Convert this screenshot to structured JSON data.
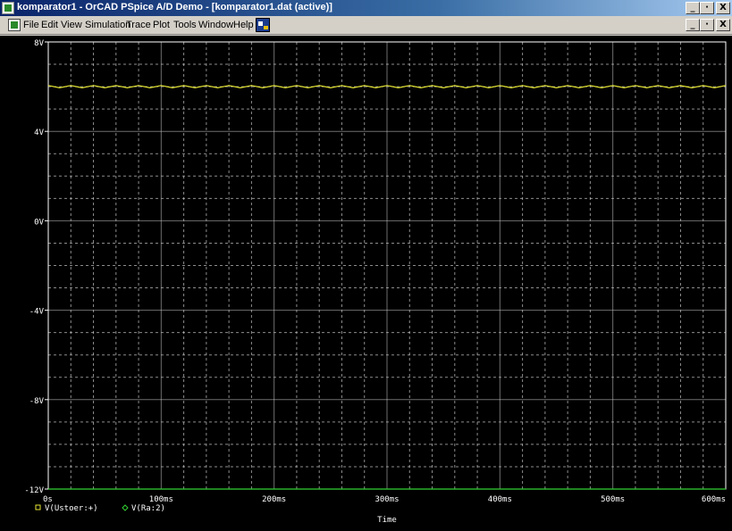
{
  "window": {
    "title": "komparator1 - OrCAD PSpice A/D Demo  - [komparator1.dat (active)]",
    "caption_buttons": [
      "_",
      "·",
      "X"
    ]
  },
  "menu": {
    "items": [
      "File",
      "Edit",
      "View",
      "Simulation",
      "Trace",
      "Plot",
      "Tools",
      "Window",
      "Help"
    ],
    "doc_buttons": [
      "_",
      "·",
      "X"
    ]
  },
  "colors": {
    "background": "#000000",
    "grid": "#c8c8c8",
    "axis": "#ffffff",
    "trace_yellow": "#e6e632",
    "trace_green": "#32d232"
  },
  "chart_data": {
    "type": "line",
    "xlabel": "Time",
    "ylabel": "",
    "x_unit": "ms",
    "xlim": [
      0,
      600
    ],
    "ylim": [
      -12,
      8
    ],
    "x_ticks": [
      0,
      100,
      200,
      300,
      400,
      500,
      600
    ],
    "x_tick_labels": [
      "0s",
      "100ms",
      "200ms",
      "300ms",
      "400ms",
      "500ms",
      "600ms"
    ],
    "y_ticks": [
      8,
      4,
      0,
      -4,
      -8,
      -12
    ],
    "y_tick_labels": [
      "8V",
      "4V",
      "0V",
      "-4V",
      "-8V",
      "-12V"
    ],
    "grid": true,
    "legend": "bottom-left",
    "series": [
      {
        "name": "V(Ustoer:+)",
        "marker": "square",
        "color": "#e6e632",
        "x": [
          0,
          10,
          20,
          30,
          40,
          50,
          60,
          70,
          80,
          90,
          100,
          110,
          120,
          130,
          140,
          150,
          160,
          170,
          180,
          190,
          200,
          210,
          220,
          230,
          240,
          250,
          260,
          270,
          280,
          290,
          300,
          310,
          320,
          330,
          340,
          350,
          360,
          370,
          380,
          390,
          400,
          410,
          420,
          430,
          440,
          450,
          460,
          470,
          480,
          490,
          500,
          510,
          520,
          530,
          540,
          550,
          560,
          570,
          580,
          590,
          600
        ],
        "values": [
          6.05,
          5.95,
          6.05,
          5.95,
          6.05,
          5.95,
          6.05,
          5.95,
          6.05,
          5.95,
          6.05,
          5.95,
          6.05,
          5.95,
          6.05,
          5.95,
          6.05,
          5.95,
          6.05,
          5.95,
          6.05,
          5.95,
          6.05,
          5.95,
          6.05,
          5.95,
          6.05,
          5.95,
          6.05,
          5.95,
          6.05,
          5.95,
          6.05,
          5.95,
          6.05,
          5.95,
          6.05,
          5.95,
          6.05,
          5.95,
          6.05,
          5.95,
          6.05,
          5.95,
          6.05,
          5.95,
          6.05,
          5.95,
          6.05,
          5.95,
          6.05,
          5.95,
          6.05,
          5.95,
          6.05,
          5.95,
          6.05,
          5.95,
          6.05,
          5.95,
          6.05
        ]
      },
      {
        "name": "V(Ra:2)",
        "marker": "diamond",
        "color": "#32d232",
        "x": [
          0,
          600
        ],
        "values": [
          -12,
          -12
        ]
      }
    ]
  }
}
